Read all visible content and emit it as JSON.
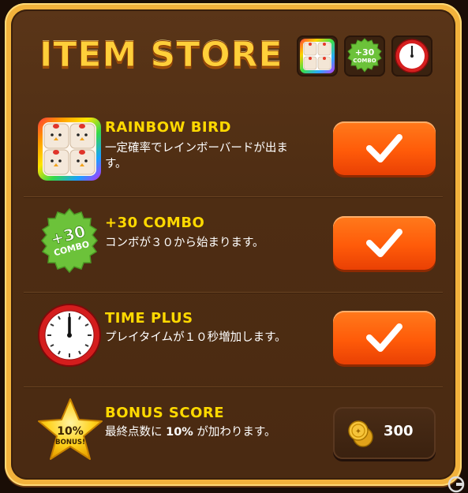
{
  "title": "ITEM STORE",
  "slots": [
    {
      "icon": "rainbow-bird-icon"
    },
    {
      "icon": "combo-icon",
      "label_top": "+30",
      "label_bottom": "COMBO"
    },
    {
      "icon": "clock-icon"
    }
  ],
  "items": [
    {
      "name": "RAINBOW BIRD",
      "desc": "一定確率でレインボーバードが出ます。",
      "icon": "rainbow-bird-icon",
      "action": "check"
    },
    {
      "name": "+30 COMBO",
      "desc": "コンボが３０から始まります。",
      "icon": "combo-icon",
      "icon_top": "+30",
      "icon_bottom": "COMBO",
      "action": "check"
    },
    {
      "name": "TIME PLUS",
      "desc": "プレイタイムが１０秒増加します。",
      "icon": "clock-icon",
      "action": "check"
    },
    {
      "name": "BONUS SCORE",
      "desc_pre": "最終点数に ",
      "desc_bold": "10%",
      "desc_post": " が加わります。",
      "icon": "bonus-star-icon",
      "icon_top": "10%",
      "icon_bottom": "BONUS!",
      "action": "buy",
      "price": "300"
    }
  ],
  "colors": {
    "accent": "#ff5b09",
    "title": "#ffcf3a",
    "item_name": "#ffd900",
    "panel_border": "#f2b23c"
  }
}
